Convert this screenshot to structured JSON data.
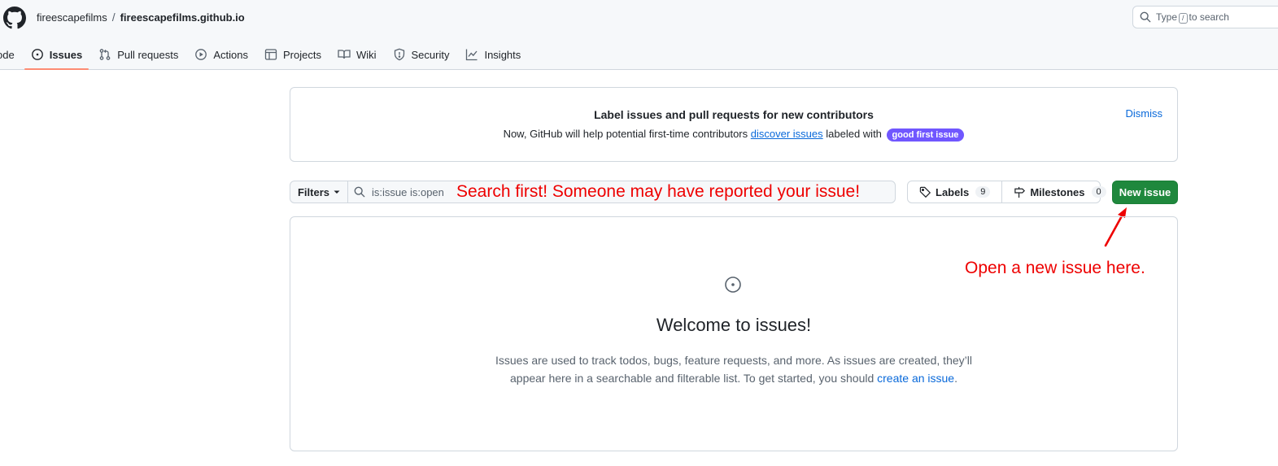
{
  "header": {
    "owner": "fireescapefilms",
    "separator": "/",
    "repo": "fireescapefilms.github.io",
    "search": {
      "prefix": "Type",
      "key": "/",
      "suffix": "to search"
    }
  },
  "tabs": [
    {
      "label": "ode",
      "icon": "code-icon"
    },
    {
      "label": "Issues",
      "icon": "issue-opened-icon",
      "active": true
    },
    {
      "label": "Pull requests",
      "icon": "git-pull-request-icon"
    },
    {
      "label": "Actions",
      "icon": "play-icon"
    },
    {
      "label": "Projects",
      "icon": "table-icon"
    },
    {
      "label": "Wiki",
      "icon": "book-icon"
    },
    {
      "label": "Security",
      "icon": "shield-icon"
    },
    {
      "label": "Insights",
      "icon": "graph-icon"
    }
  ],
  "banner": {
    "title": "Label issues and pull requests for new contributors",
    "text_before": "Now, GitHub will help potential first-time contributors",
    "link": "discover issues",
    "text_after": "labeled with",
    "label": "good first issue",
    "dismiss": "Dismiss"
  },
  "filterbar": {
    "filters_label": "Filters",
    "query": "is:issue is:open",
    "annotation": "Search first! Someone may have reported your issue!"
  },
  "labels": {
    "label": "Labels",
    "count": "9"
  },
  "milestones": {
    "label": "Milestones",
    "count": "0"
  },
  "new_issue": {
    "label": "New issue",
    "annotation": "Open a new issue here."
  },
  "blank_slate": {
    "title": "Welcome to issues!",
    "line1": "Issues are used to track todos, bugs, feature requests, and more. As issues are created, they’ll",
    "line2_before": "appear here in a searchable and filterable list. To get started, you should",
    "line2_link": "create an issue",
    "line2_after": "."
  },
  "colors": {
    "accent": "#0969da",
    "primary_button": "#1f883d",
    "label_good_first_issue": "#7057ff",
    "annotation": "#ee0000",
    "active_tab_underline": "#fd8c73"
  }
}
